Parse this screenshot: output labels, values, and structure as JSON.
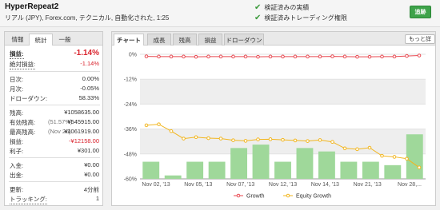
{
  "header": {
    "title": "HyperRepeat2",
    "subtitle": "リアル (JPY), Forex.com, テクニカル, 自動化された, 1:25",
    "verified_track_record": "検証済みの実績",
    "verified_trading_privileges": "検証済みトレーディング権限",
    "follow_button": "追跡",
    "check_color": "#3a9a3a"
  },
  "left_tabs": [
    "情報",
    "統計",
    "一般"
  ],
  "stats": {
    "gain_label": "損益:",
    "gain_value": "-1.14%",
    "abs_gain_label": "絶対損益:",
    "abs_gain_value": "-1.14%",
    "daily_label": "日次:",
    "daily_value": "0.00%",
    "monthly_label": "月次:",
    "monthly_value": "-0.05%",
    "drawdown_label": "ドローダウン:",
    "drawdown_value": "58.33%",
    "balance_label": "残高:",
    "balance_value": "¥1058635.00",
    "equity_label": "有効残高:",
    "equity_note": "(51.57%)",
    "equity_value": "¥545915.00",
    "highest_label": "最高残高:",
    "highest_note": "(Nov 26)",
    "highest_value": "¥1061919.00",
    "profit_label": "損益:",
    "profit_value": "-¥12158.00",
    "interest_label": "利子:",
    "interest_value": "¥301.00",
    "deposits_label": "入金:",
    "deposits_value": "¥0.00",
    "withdrawals_label": "出金:",
    "withdrawals_value": "¥0.00",
    "updated_label": "更新:",
    "updated_value": "4分前",
    "tracking_label": "トラッキング:",
    "tracking_value": "1",
    "negative_color": "#d9232d"
  },
  "chart_panel": {
    "label": "チャート",
    "tabs": [
      "成長",
      "残高",
      "損益",
      "ドローダウン"
    ],
    "more_button": "もっと詳"
  },
  "chart_data": {
    "type": "line",
    "x": [
      "Nov 02, '13",
      "Nov 05, '13",
      "Nov 07, '13",
      "Nov 12, '13",
      "Nov 14, '13",
      "Nov 21, '13",
      "Nov 28,..."
    ],
    "yticks": [
      "0%",
      "-12%",
      "-24%",
      "-36%",
      "-48%",
      "-60%"
    ],
    "ylim": [
      -60,
      0
    ],
    "series": [
      {
        "name": "Growth",
        "color": "#e8474f",
        "values": [
          -1.0,
          -1.1,
          -1.1,
          -1.1,
          -1.2,
          -1.1,
          -1.1,
          -1.1,
          -1.1,
          -1.2,
          -1.1,
          -1.1,
          -1.1,
          -1.1,
          -1.1,
          -1.0,
          -1.1,
          -1.2,
          -1.2,
          -1.1,
          -1.1,
          -0.8,
          -0.6
        ]
      },
      {
        "name": "Equity Growth",
        "color": "#f2b61f",
        "values": [
          -34.2,
          -33.7,
          -37.0,
          -40.6,
          -39.9,
          -40.4,
          -40.6,
          -41.4,
          -41.7,
          -41.0,
          -40.9,
          -41.2,
          -41.5,
          -41.8,
          -41.3,
          -42.2,
          -45.3,
          -45.7,
          -45.0,
          -48.9,
          -49.4,
          -50.3,
          -54.5
        ]
      }
    ],
    "bars": {
      "color": "#9fd89a",
      "values": [
        5,
        1,
        5,
        5,
        9,
        10,
        5,
        9,
        8,
        5,
        5,
        4,
        13
      ]
    },
    "bands": true,
    "legend_position": "bottom"
  }
}
